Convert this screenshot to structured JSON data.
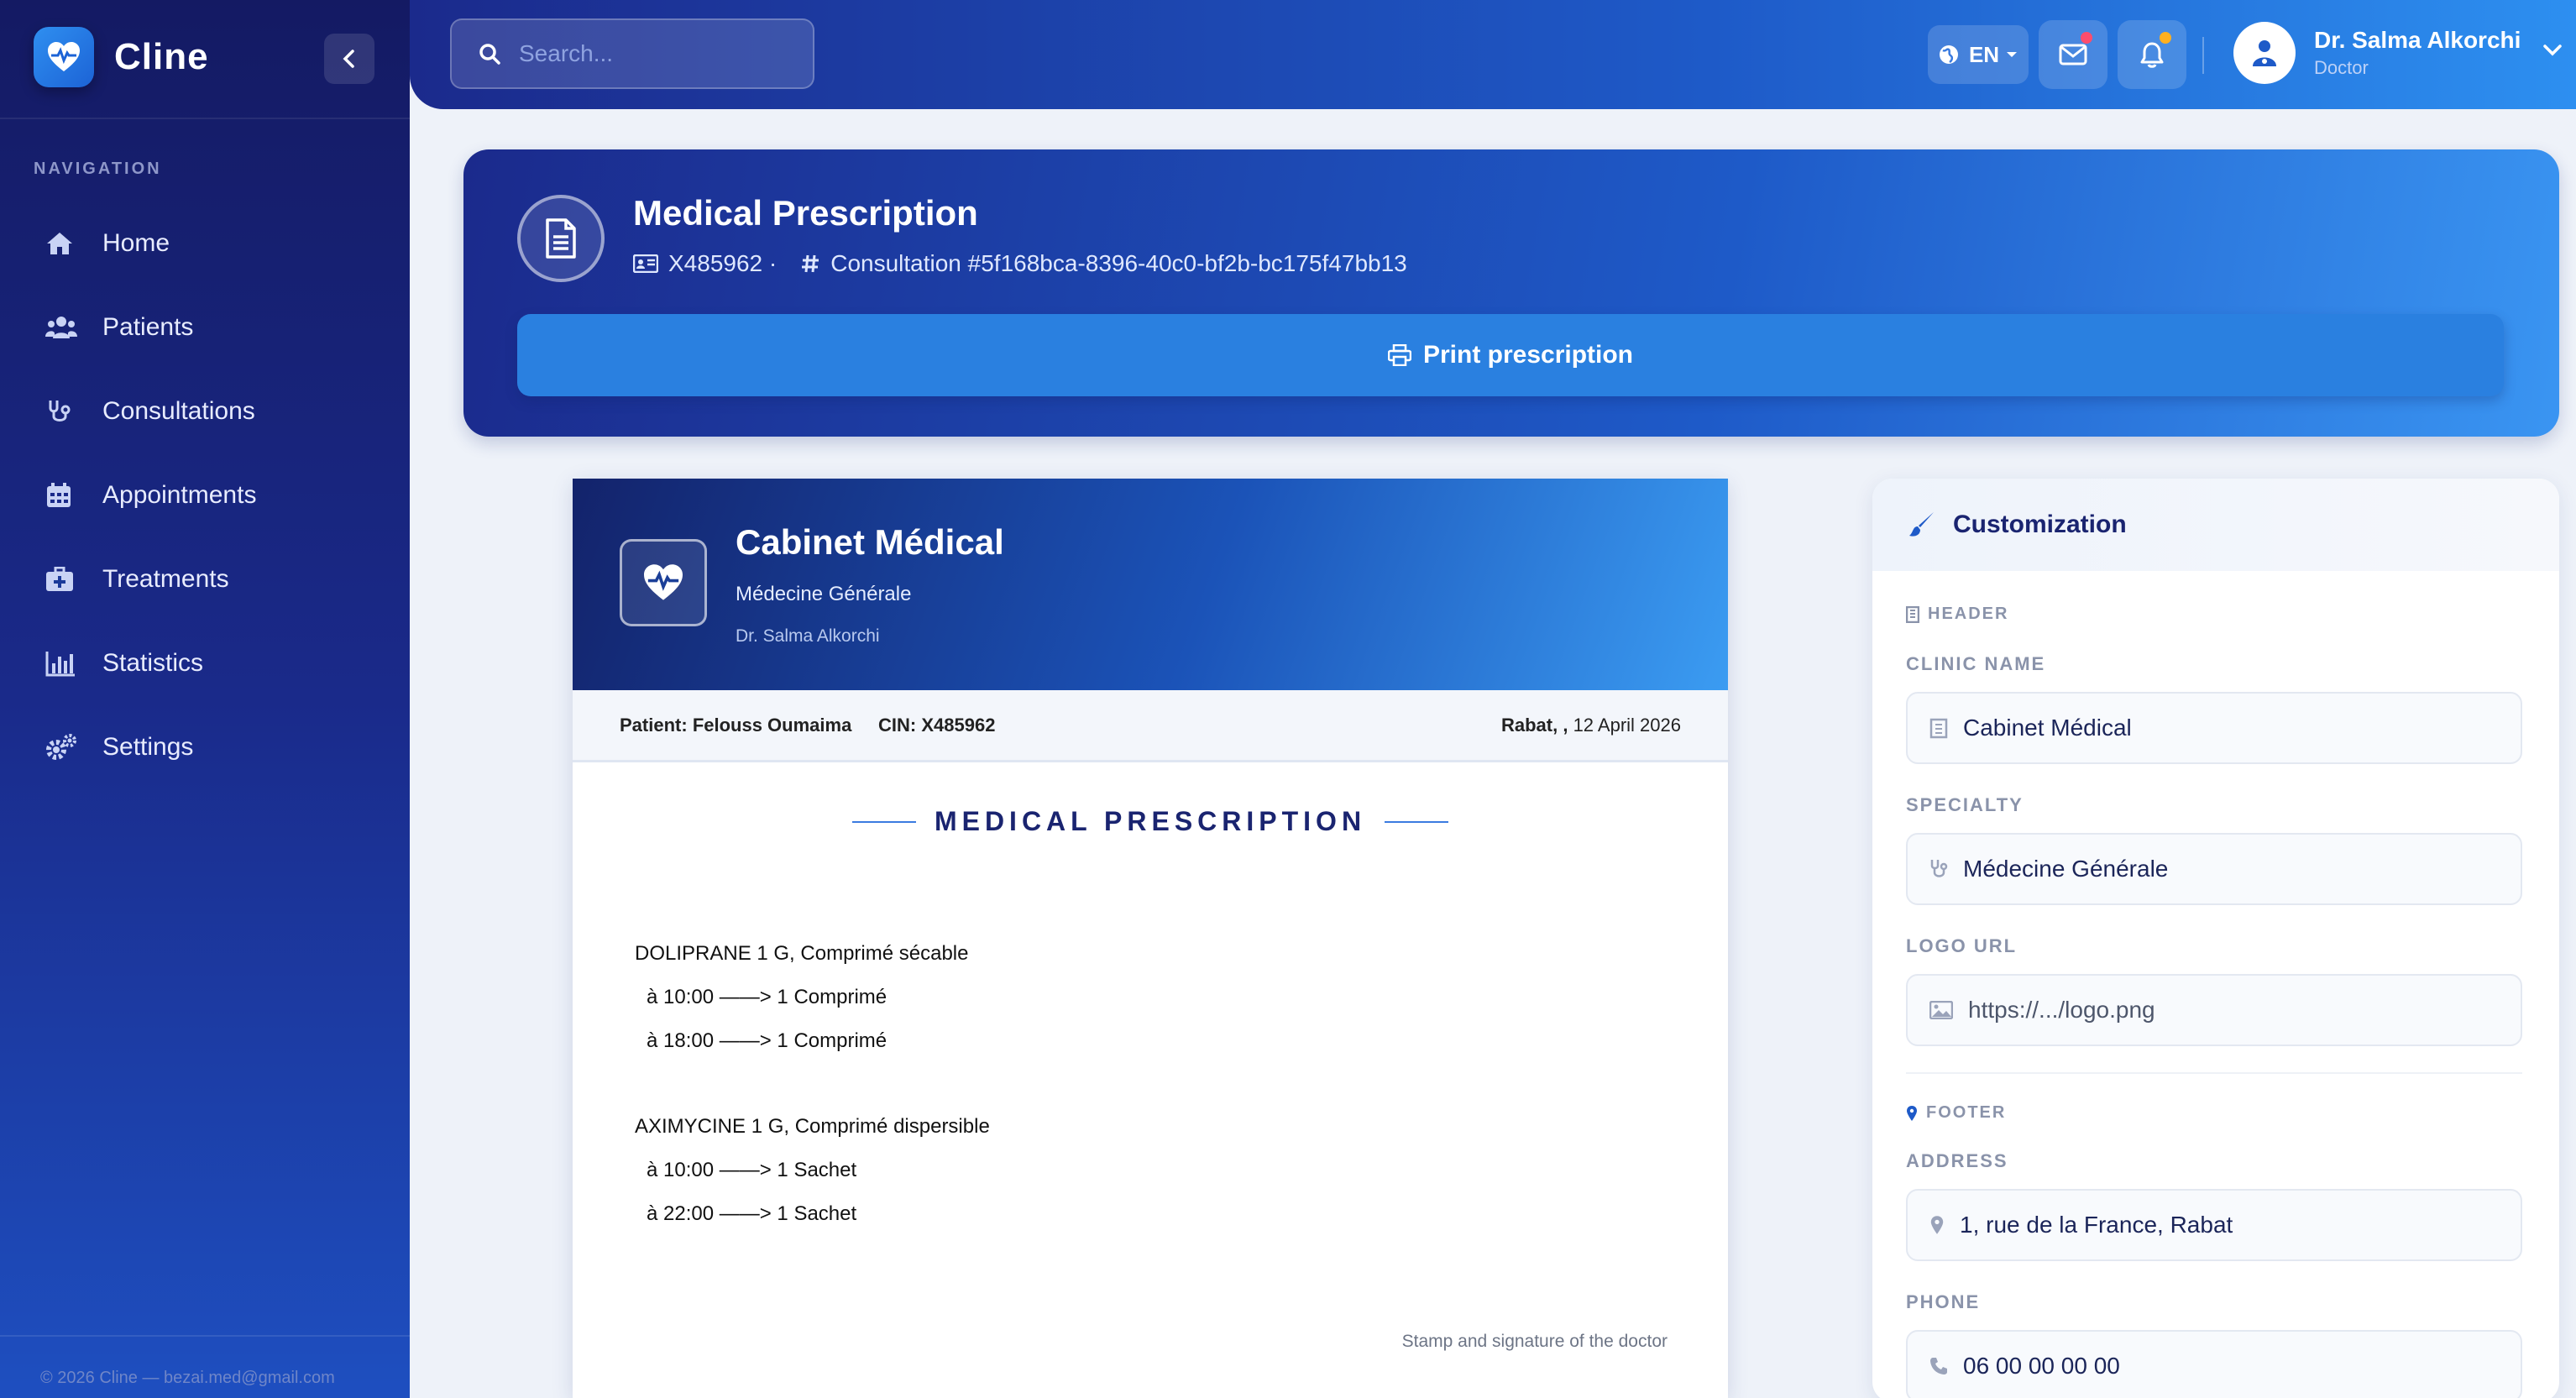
{
  "app": {
    "name": "Cline",
    "nav_title": "NAVIGATION",
    "nav": [
      {
        "label": "Home",
        "icon": "home-icon"
      },
      {
        "label": "Patients",
        "icon": "users-icon"
      },
      {
        "label": "Consultations",
        "icon": "stethoscope-icon"
      },
      {
        "label": "Appointments",
        "icon": "calendar-icon"
      },
      {
        "label": "Treatments",
        "icon": "medkit-icon"
      },
      {
        "label": "Statistics",
        "icon": "bar-chart-icon"
      },
      {
        "label": "Settings",
        "icon": "gears-icon"
      }
    ],
    "footer": "© 2026 Cline — bezai.med@gmail.com"
  },
  "topbar": {
    "search_placeholder": "Search...",
    "language": "EN",
    "user_name": "Dr. Salma Alkorchi",
    "user_role": "Doctor",
    "mail_badge_color": "#ff4d6d",
    "bell_badge_color": "#ffb020"
  },
  "hero": {
    "title": "Medical Prescription",
    "patient_id": "X485962 ·",
    "consultation": "Consultation #5f168bca-8396-40c0-bf2b-bc175f47bb13",
    "print_label": "Print prescription"
  },
  "prescription": {
    "clinic": "Cabinet Médical",
    "specialty": "Médecine Générale",
    "doctor": "Dr. Salma Alkorchi",
    "patient_label": "Patient:",
    "patient_name": "Felouss Oumaima",
    "cin_label": "CIN:",
    "cin": "X485962",
    "city": "Rabat, ,",
    "date": "12 April 2026",
    "title": "MEDICAL PRESCRIPTION",
    "medications": [
      {
        "name": "DOLIPRANE 1 G, Comprimé sécable",
        "doses": [
          "à 10:00 ——> 1 Comprimé",
          "à 18:00 ——> 1 Comprimé"
        ]
      },
      {
        "name": "AXIMYCINE 1 G, Comprimé dispersible",
        "doses": [
          "à 10:00 ——> 1 Sachet",
          "à 22:00 ——> 1 Sachet"
        ]
      }
    ],
    "stamp": "Stamp and signature of the doctor"
  },
  "customization": {
    "title": "Customization",
    "header_section": "HEADER",
    "clinic_name_label": "CLINIC NAME",
    "clinic_name_value": "Cabinet Médical",
    "specialty_label": "SPECIALTY",
    "specialty_value": "Médecine Générale",
    "logo_label": "LOGO URL",
    "logo_placeholder": "https://.../logo.png",
    "footer_section": "FOOTER",
    "address_label": "ADDRESS",
    "address_value": "1, rue de la France, Rabat",
    "phone_label": "PHONE",
    "phone_value": "06 00 00 00 00"
  }
}
